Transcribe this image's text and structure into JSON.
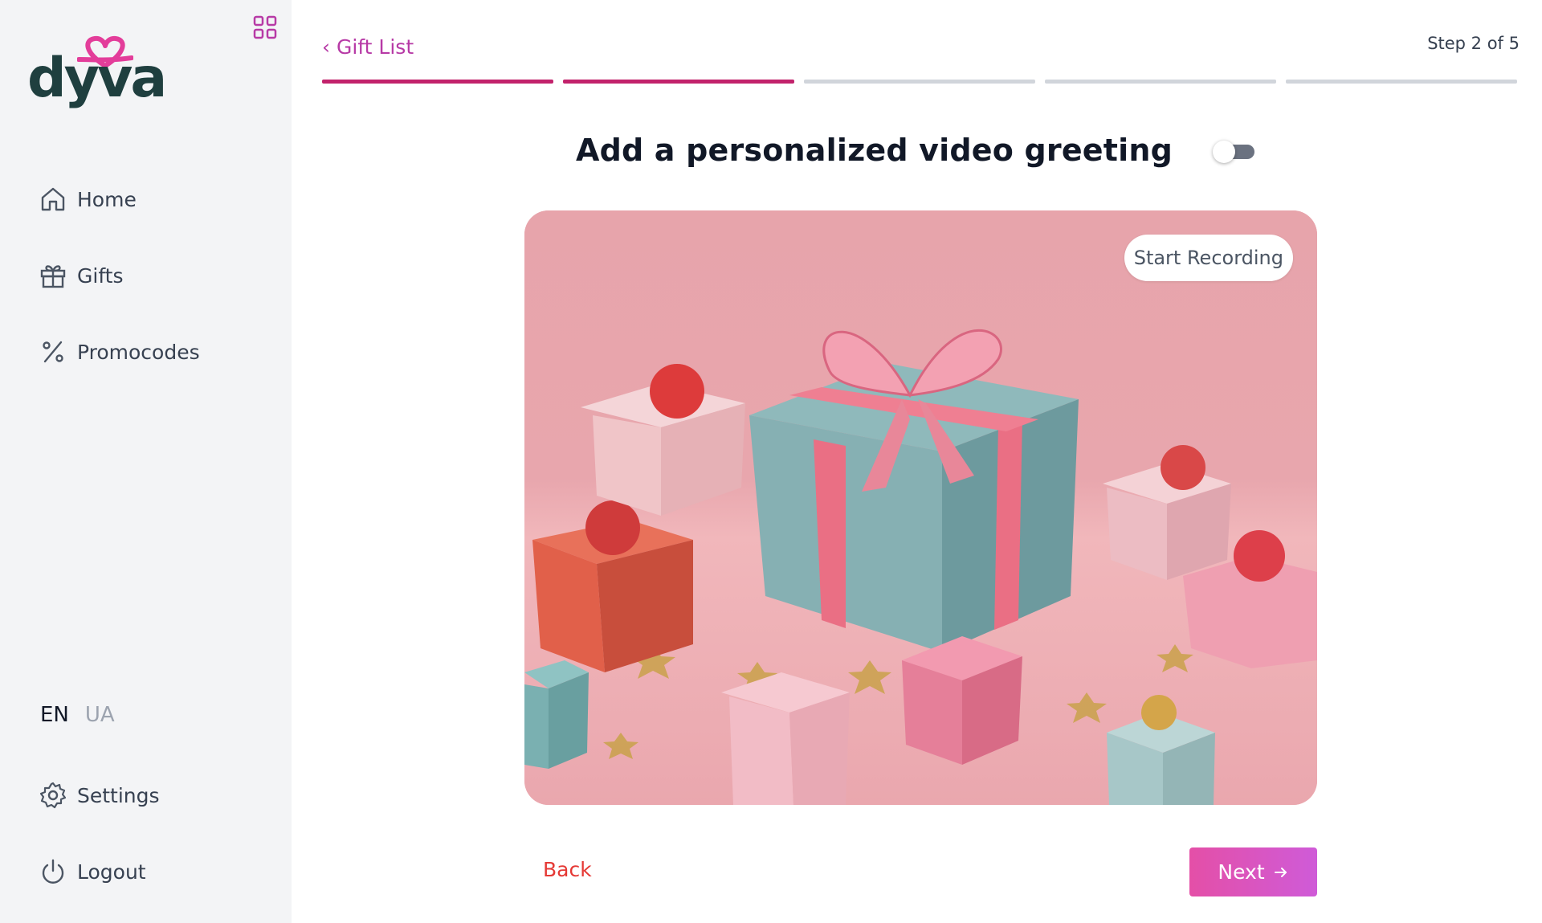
{
  "brand": {
    "logo_text": "dyva",
    "logo_color": "#1f3f3f",
    "heart_color": "#e33d9a"
  },
  "sidebar": {
    "toggle_icon": "grid-icon",
    "items": [
      {
        "label": "Home",
        "icon": "home-icon"
      },
      {
        "label": "Gifts",
        "icon": "gift-icon"
      },
      {
        "label": "Promocodes",
        "icon": "percent-icon"
      }
    ],
    "languages": {
      "active": "EN",
      "inactive": "UA"
    },
    "bottom_items": [
      {
        "label": "Settings",
        "icon": "gear-icon"
      },
      {
        "label": "Logout",
        "icon": "power-icon"
      }
    ]
  },
  "header": {
    "back_link": "Gift List",
    "back_icon": "chevron-left-icon",
    "step_text": "Step 2 of 5",
    "progress": {
      "total_steps": 5,
      "completed_steps": 2,
      "active_color": "#c2226b",
      "inactive_color": "#d1d5db"
    }
  },
  "main": {
    "title": "Add a personalized video greeting",
    "video_toggle_on": false,
    "preview": {
      "image": "pink-gift-boxes-illustration",
      "record_button": "Start Recording"
    },
    "back_button": "Back",
    "next_button": "Next",
    "next_icon": "arrow-right-icon"
  },
  "colors": {
    "accent": "#b73aa6",
    "danger": "#e53935",
    "next_gradient_start": "#e44fa7",
    "next_gradient_end": "#cf5bd8"
  }
}
